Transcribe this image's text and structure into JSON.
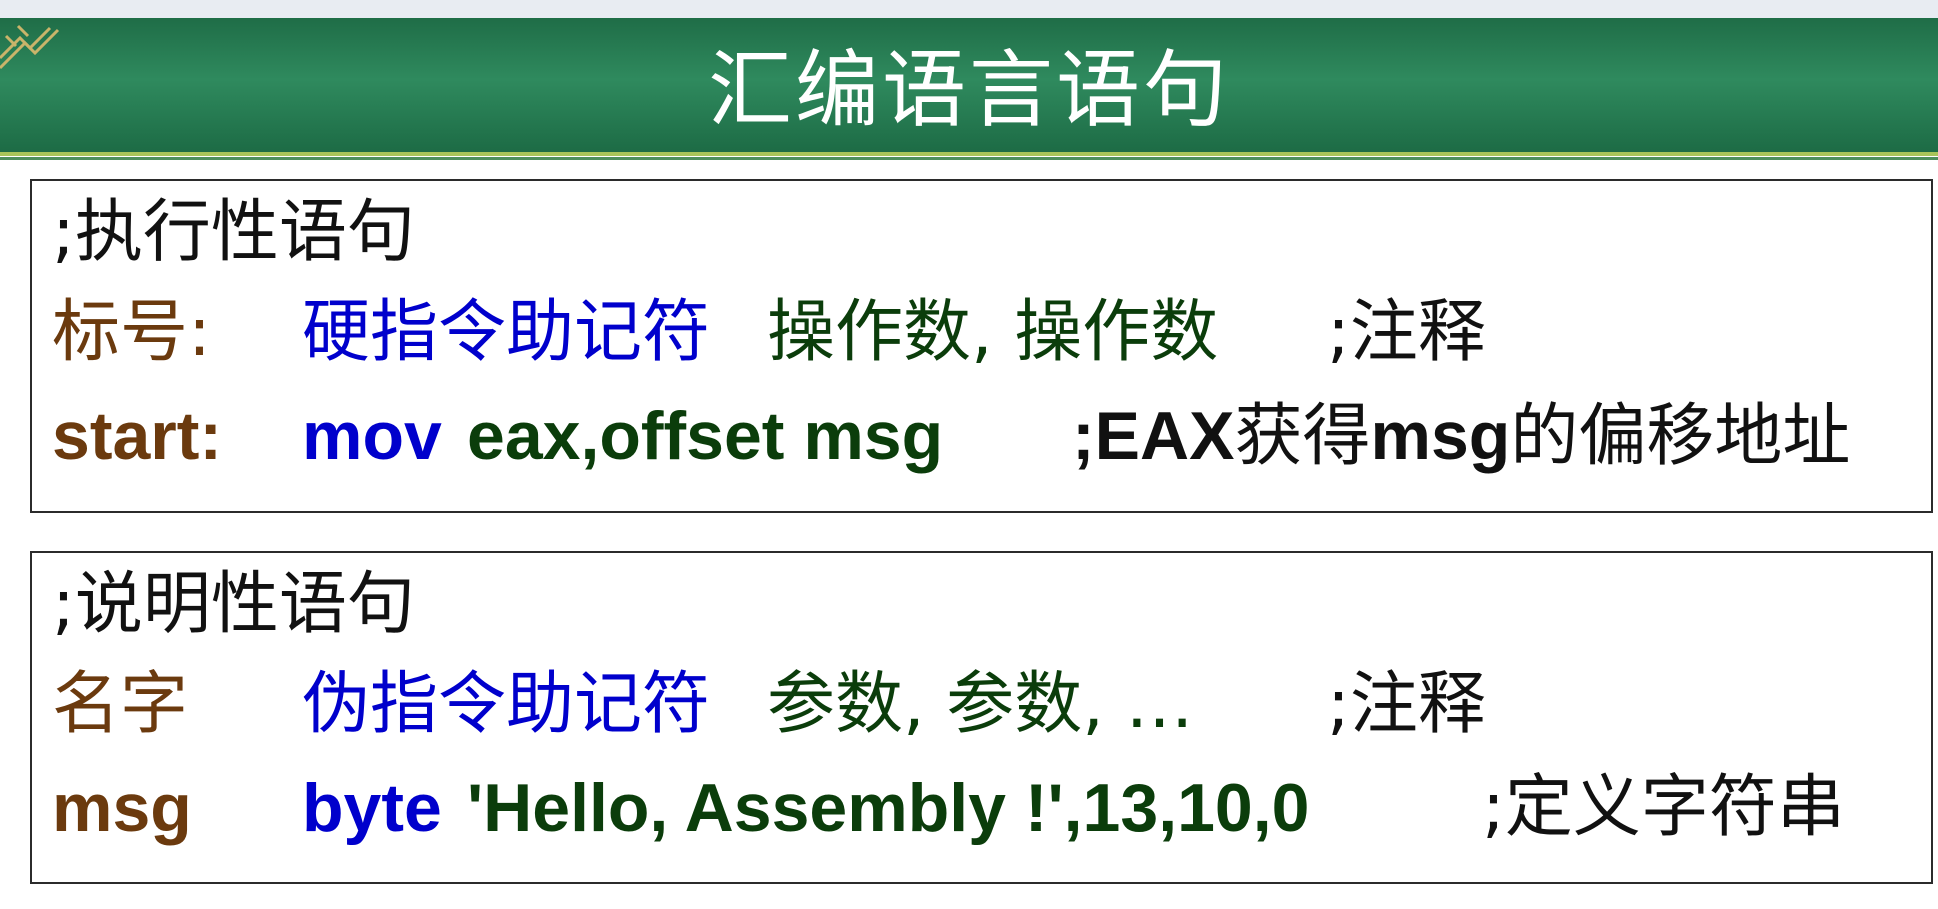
{
  "slide": {
    "title": "汇编语言语句"
  },
  "exec_box": {
    "heading": ";执行性语句",
    "format": {
      "label": "标号:",
      "mnemonic": "硬指令助记符",
      "operands": "操作数, 操作数",
      "comment": ";注释"
    },
    "example": {
      "label": "start:",
      "mnemonic": "mov",
      "operands": "eax,offset msg",
      "comment_prefix": ";EAX",
      "comment_mid": "获得",
      "comment_word": "msg",
      "comment_suffix": "的偏移地址"
    }
  },
  "decl_box": {
    "heading": ";说明性语句",
    "format": {
      "name": "名字",
      "mnemonic": "伪指令助记符",
      "params": "参数, 参数, …",
      "comment": ";注释"
    },
    "example": {
      "name": "msg",
      "mnemonic": "byte",
      "params": "'Hello, Assembly !',13,10,0",
      "comment": ";定义字符串"
    }
  },
  "colors": {
    "banner": "#2f8a5e",
    "label": "#6b3a0e",
    "mnemonic": "#0000cc",
    "operand": "#0b3d0b",
    "comment": "#111111"
  }
}
